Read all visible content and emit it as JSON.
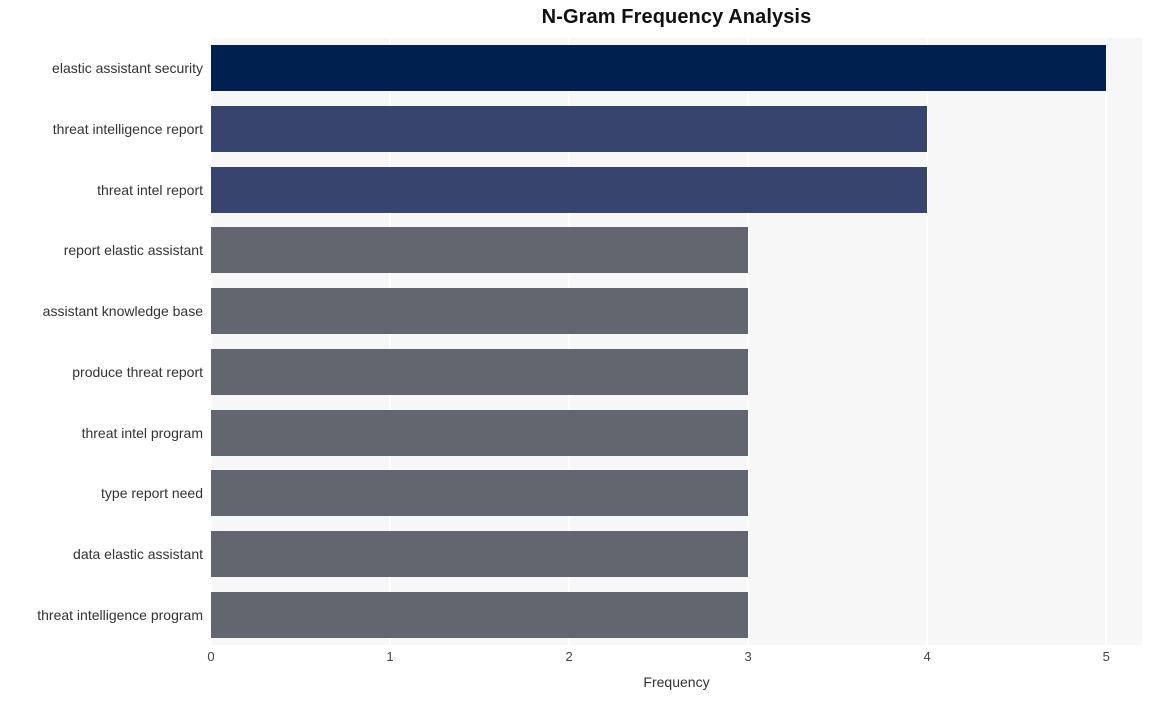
{
  "chart_data": {
    "type": "bar",
    "orientation": "horizontal",
    "title": "N-Gram Frequency Analysis",
    "xlabel": "Frequency",
    "ylabel": "",
    "categories": [
      "elastic assistant security",
      "threat intelligence report",
      "threat intel report",
      "report elastic assistant",
      "assistant knowledge base",
      "produce threat report",
      "threat intel program",
      "type report need",
      "data elastic assistant",
      "threat intelligence program"
    ],
    "values": [
      5,
      4,
      4,
      3,
      3,
      3,
      3,
      3,
      3,
      3
    ],
    "bar_colors": [
      "#002050",
      "#37446e",
      "#37446e",
      "#63666e",
      "#63666e",
      "#63666e",
      "#63666e",
      "#63666e",
      "#63666e",
      "#63666e"
    ],
    "xlim": [
      0,
      5.2
    ],
    "xticks": [
      0,
      1,
      2,
      3,
      4,
      5
    ],
    "xtick_labels": [
      "0",
      "1",
      "2",
      "3",
      "4",
      "5"
    ],
    "grid": true,
    "grid_axis": "x",
    "grid_color": "#ffffff",
    "plot_background": "#f7f7f7",
    "figure_background": "#ffffff",
    "legend": null
  },
  "colors": {
    "title_text": "#111111",
    "axis_text": "#333333",
    "tick_text": "#444444"
  }
}
